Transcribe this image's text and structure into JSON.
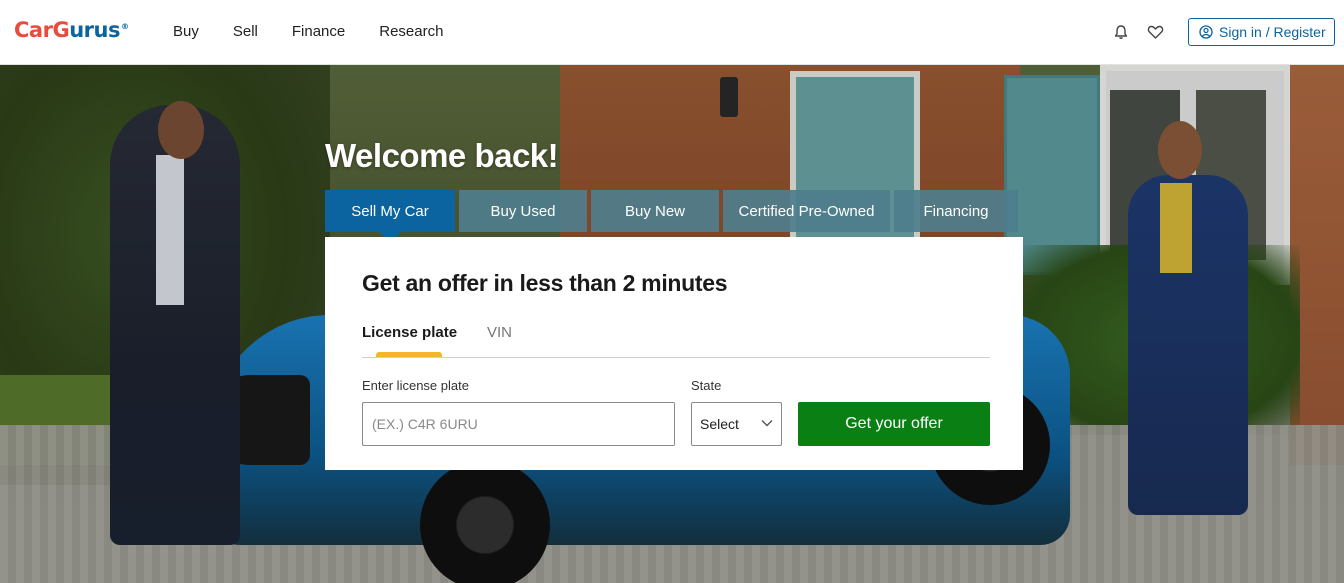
{
  "header": {
    "logo": {
      "car": "CarG",
      "gurus": "urus",
      "reg": "®"
    },
    "nav": [
      "Buy",
      "Sell",
      "Finance",
      "Research"
    ],
    "icons": [
      "bell-icon",
      "heart-icon",
      "user-circle-icon"
    ],
    "signin_label": "Sign in / Register",
    "accent_color": "#0b64a0"
  },
  "hero": {
    "welcome": "Welcome back!",
    "tabs": [
      {
        "label": "Sell My Car",
        "active": true
      },
      {
        "label": "Buy Used",
        "active": false
      },
      {
        "label": "Buy New",
        "active": false
      },
      {
        "label": "Certified Pre-Owned",
        "active": false
      },
      {
        "label": "Financing",
        "active": false
      }
    ]
  },
  "offer": {
    "title": "Get an offer in less than 2 minutes",
    "sub_tabs": [
      {
        "label": "License plate",
        "active": true
      },
      {
        "label": "VIN",
        "active": false
      }
    ],
    "plate_label": "Enter license plate",
    "plate_placeholder": "(EX.) C4R 6URU",
    "plate_value": "",
    "state_label": "State",
    "state_value": "Select",
    "button_label": "Get your offer",
    "button_color": "#0a7f14",
    "underline_color": "#f1b82d"
  }
}
